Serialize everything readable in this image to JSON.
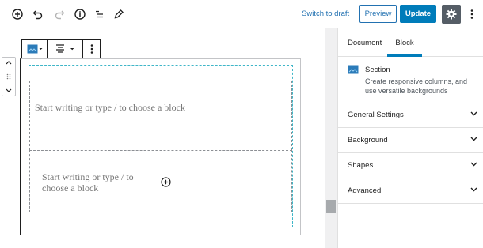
{
  "toolbar": {
    "switch_to_draft": "Switch to draft",
    "preview": "Preview",
    "update": "Update",
    "icons": [
      "add-block-icon",
      "undo-icon",
      "redo-icon",
      "info-icon",
      "list-view-icon",
      "edit-icon",
      "gear-icon",
      "more-vertical-icon"
    ]
  },
  "editor": {
    "block_toolbar": [
      "section-block-icon",
      "align-icon",
      "more-options-icon"
    ],
    "columns": [
      {
        "placeholder": "Start writing or type / to choose a block"
      },
      {
        "placeholder": "Start writing or type / to choose a block"
      }
    ]
  },
  "sidebar": {
    "tabs": [
      {
        "label": "Document",
        "active": false
      },
      {
        "label": "Block",
        "active": true
      }
    ],
    "block_card": {
      "title": "Section",
      "description": "Create responsive columns, and use versatile backgrounds"
    },
    "panels": [
      {
        "label": "General Settings"
      },
      {
        "label": "Background"
      },
      {
        "label": "Shapes"
      },
      {
        "label": "Advanced"
      }
    ]
  },
  "colors": {
    "accent": "#007cba",
    "link": "#2271b1",
    "dashed_outline": "#3fb6c8",
    "settings_bg": "#555d66"
  }
}
